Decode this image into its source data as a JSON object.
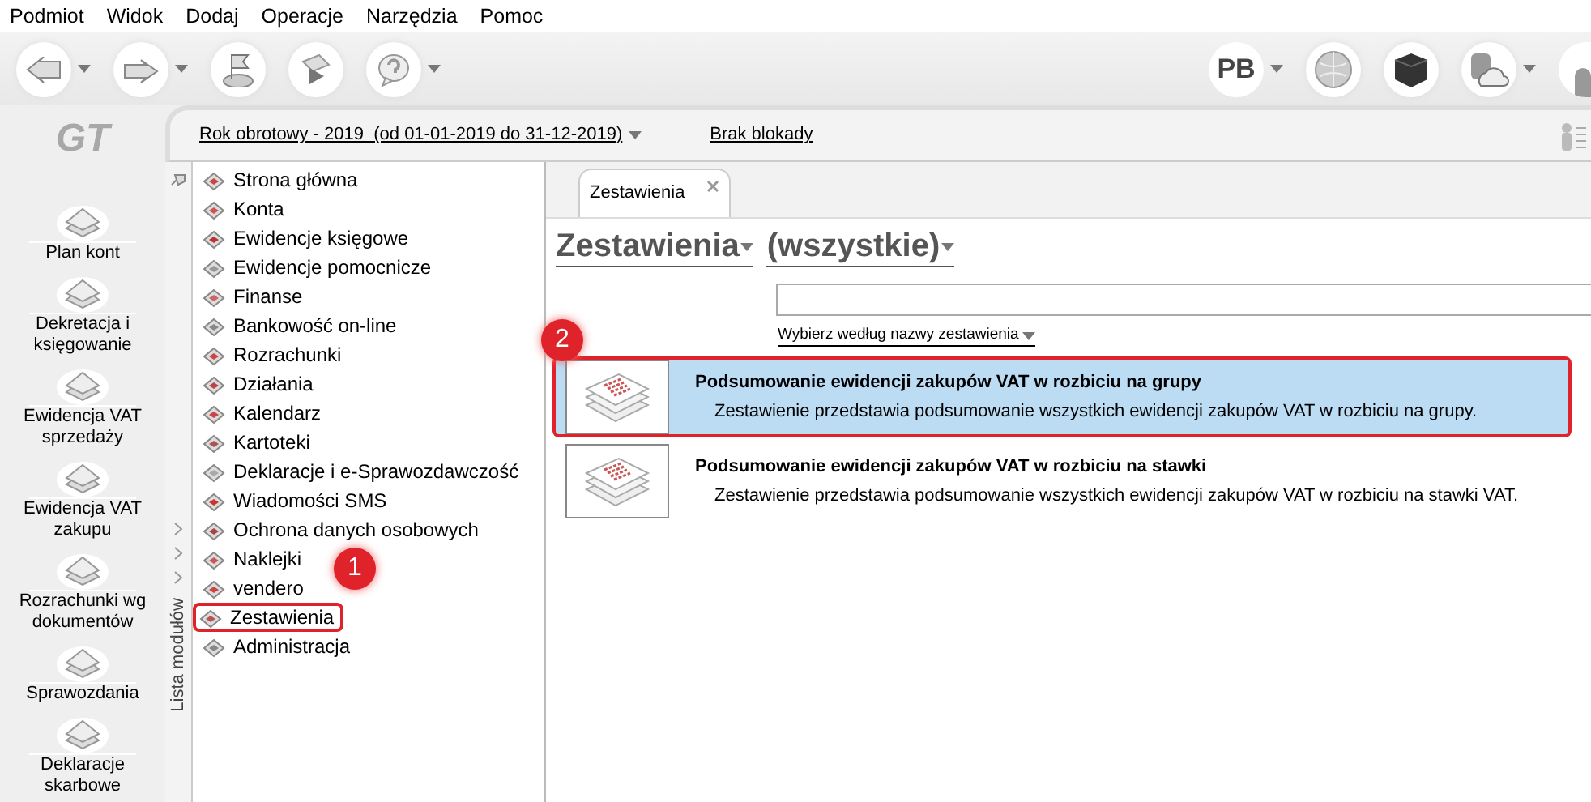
{
  "menu": [
    "Podmiot",
    "Widok",
    "Dodaj",
    "Operacje",
    "Narzędzia",
    "Pomoc"
  ],
  "toolbar": {
    "user_initials": "PB"
  },
  "logo": "GT",
  "header": {
    "fiscal_year": "Rok obrotowy - 2019  (od 01-01-2019 do 31-12-2019)",
    "lock": "Brak blokady"
  },
  "left_nav": [
    {
      "label": "Plan kont"
    },
    {
      "label": "Dekretacja i księgowanie"
    },
    {
      "label": "Ewidencja VAT sprzedaży"
    },
    {
      "label": "Ewidencja VAT zakupu"
    },
    {
      "label": "Rozrachunki wg dokumentów"
    },
    {
      "label": "Sprawozdania"
    },
    {
      "label": "Deklaracje skarbowe"
    }
  ],
  "modules": {
    "title": "Lista modułów",
    "items": [
      {
        "label": "Strona główna",
        "highlighted": false
      },
      {
        "label": "Konta",
        "highlighted": false
      },
      {
        "label": "Ewidencje księgowe",
        "highlighted": false
      },
      {
        "label": "Ewidencje pomocnicze",
        "highlighted": false
      },
      {
        "label": "Finanse",
        "highlighted": false
      },
      {
        "label": "Bankowość on-line",
        "highlighted": false
      },
      {
        "label": "Rozrachunki",
        "highlighted": false
      },
      {
        "label": "Działania",
        "highlighted": false
      },
      {
        "label": "Kalendarz",
        "highlighted": false
      },
      {
        "label": "Kartoteki",
        "highlighted": false
      },
      {
        "label": "Deklaracje i e-Sprawozdawczość",
        "highlighted": false
      },
      {
        "label": "Wiadomości SMS",
        "highlighted": false
      },
      {
        "label": "Ochrona danych osobowych",
        "highlighted": false
      },
      {
        "label": "Naklejki",
        "highlighted": false
      },
      {
        "label": "vendero",
        "highlighted": false
      },
      {
        "label": "Zestawienia",
        "highlighted": true
      },
      {
        "label": "Administracja",
        "highlighted": false
      }
    ]
  },
  "tabs": [
    {
      "label": "Zestawienia",
      "selected": true
    }
  ],
  "content": {
    "title": "Zestawienia",
    "filter": "(wszystkie)",
    "sort_link": "Wybierz według nazwy zestawienia",
    "reports": [
      {
        "title": "Podsumowanie ewidencji zakupów VAT w rozbiciu na grupy",
        "description": "Zestawienie przedstawia podsumowanie wszystkich ewidencji zakupów VAT w rozbiciu na grupy.",
        "selected": true,
        "highlighted": true
      },
      {
        "title": "Podsumowanie ewidencji zakupów VAT w rozbiciu na stawki",
        "description": "Zestawienie przedstawia podsumowanie wszystkich ewidencji zakupów VAT w rozbiciu na stawki VAT.",
        "selected": false,
        "highlighted": false
      }
    ]
  },
  "annotations": [
    {
      "number": "1"
    },
    {
      "number": "2"
    }
  ]
}
